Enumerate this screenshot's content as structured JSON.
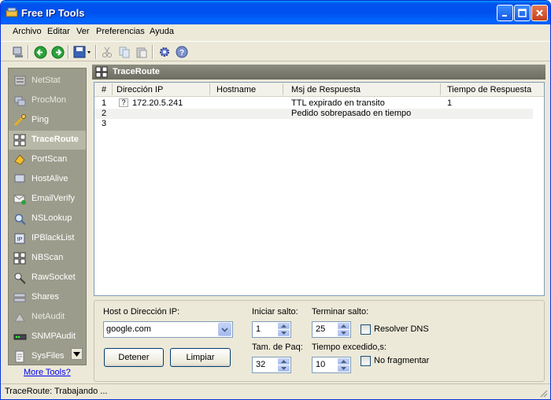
{
  "window": {
    "title": "Free IP Tools"
  },
  "menu": [
    "Archivo",
    "Editar",
    "Ver",
    "Preferencias",
    "Ayuda"
  ],
  "sidebar": {
    "items": [
      {
        "label": "NetStat",
        "icon": "netstat-icon"
      },
      {
        "label": "ProcMon",
        "icon": "procmon-icon"
      },
      {
        "label": "Ping",
        "icon": "ping-icon"
      },
      {
        "label": "TraceRoute",
        "icon": "traceroute-icon"
      },
      {
        "label": "PortScan",
        "icon": "portscan-icon"
      },
      {
        "label": "HostAlive",
        "icon": "hostalive-icon"
      },
      {
        "label": "EmailVerify",
        "icon": "emailverify-icon"
      },
      {
        "label": "NSLookup",
        "icon": "nslookup-icon"
      },
      {
        "label": "IPBlackList",
        "icon": "ipblacklist-icon"
      },
      {
        "label": "NBScan",
        "icon": "nbscan-icon"
      },
      {
        "label": "RawSocket",
        "icon": "rawsocket-icon"
      },
      {
        "label": "Shares",
        "icon": "shares-icon"
      },
      {
        "label": "NetAudit",
        "icon": "netaudit-icon"
      },
      {
        "label": "SNMPAudit",
        "icon": "snmpaudit-icon"
      },
      {
        "label": "SysFiles",
        "icon": "sysfiles-icon"
      }
    ],
    "active": "TraceRoute",
    "more_tools": "More Tools?"
  },
  "panel": {
    "title": "TraceRoute"
  },
  "grid": {
    "columns": [
      "#",
      "Dirección IP",
      "Hostname",
      "Msj de Respuesta",
      "Tiempo de Respuesta"
    ],
    "rows": [
      {
        "num": "1",
        "ip_icon": "?",
        "ip": "172.20.5.241",
        "hostname": "",
        "msg": "TTL expirado en transito",
        "time": "1"
      },
      {
        "num": "2",
        "ip_icon": "",
        "ip": "",
        "hostname": "",
        "msg": "Pedido sobrepasado en tiempo",
        "time": ""
      },
      {
        "num": "3",
        "ip_icon": "",
        "ip": "",
        "hostname": "",
        "msg": "",
        "time": ""
      }
    ]
  },
  "controls": {
    "host_label": "Host o Dirección IP:",
    "host_value": "google.com",
    "start_hop_label": "Iniciar salto:",
    "start_hop_value": "1",
    "end_hop_label": "Terminar salto:",
    "end_hop_value": "25",
    "resolve_dns_label": "Resolver DNS",
    "packet_size_label": "Tam. de Paq:",
    "packet_size_value": "32",
    "timeout_label": "Tiempo excedido,s:",
    "timeout_value": "10",
    "no_fragment_label": "No fragmentar",
    "stop_button": "Detener",
    "clear_button": "Limpiar"
  },
  "status": {
    "text": "TraceRoute: Trabajando ..."
  },
  "colors": {
    "titlebar": "#0053ee",
    "sidebar": "#9c9c8c",
    "panel_header": "#7c7c70",
    "link": "#0000ee"
  }
}
